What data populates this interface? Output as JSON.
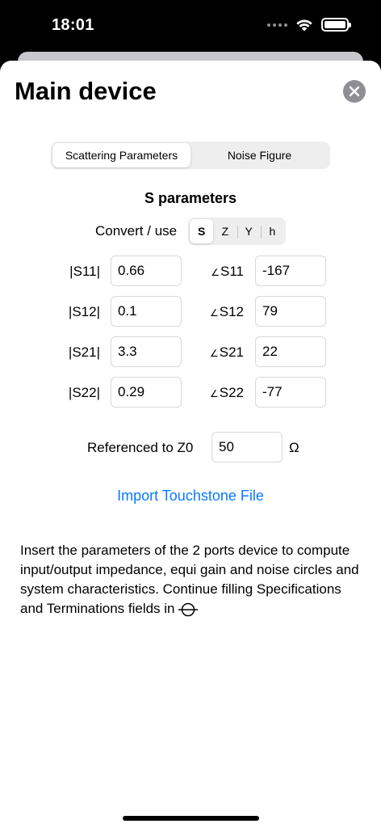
{
  "status_bar": {
    "time": "18:01",
    "icons": [
      "signal-dots-icon",
      "wifi-icon",
      "battery-icon"
    ]
  },
  "sheet": {
    "title": "Main device",
    "close_icon": "xmark-circle-icon"
  },
  "tabs": [
    {
      "label": "Scattering Parameters",
      "selected": true
    },
    {
      "label": "Noise Figure",
      "selected": false
    }
  ],
  "s_params": {
    "section_title": "S parameters",
    "convert_label": "Convert / use",
    "convert_options": [
      {
        "label": "S",
        "selected": true
      },
      {
        "label": "Z",
        "selected": false
      },
      {
        "label": "Y",
        "selected": false
      },
      {
        "label": "h",
        "selected": false
      }
    ],
    "angle_symbol": "∠",
    "rows": [
      {
        "mag_label": "|S11|",
        "mag_value": "0.66",
        "ang_label": "S11",
        "ang_value": "-167"
      },
      {
        "mag_label": "|S12|",
        "mag_value": "0.1",
        "ang_label": "S12",
        "ang_value": "79"
      },
      {
        "mag_label": "|S21|",
        "mag_value": "3.3",
        "ang_label": "S21",
        "ang_value": "22"
      },
      {
        "mag_label": "|S22|",
        "mag_value": "0.29",
        "ang_label": "S22",
        "ang_value": "-77"
      }
    ],
    "z0_label": "Referenced to Z0",
    "z0_value": "50",
    "z0_unit": "Ω"
  },
  "import_link": "Import Touchstone File",
  "description": "Insert the parameters of the 2 ports device to compute input/output impedance, equi gain and noise circles and system characteristics. Continue filling Specifications and Terminations fields in",
  "description_icon": "smith-chart-icon"
}
